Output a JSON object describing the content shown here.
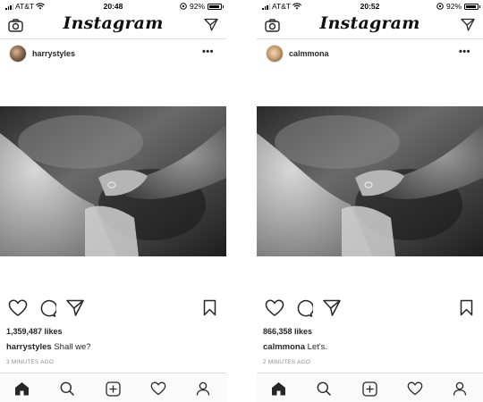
{
  "app": {
    "logo": "Instagram"
  },
  "screens": [
    {
      "status": {
        "carrier": "AT&T",
        "time": "20:48",
        "battery": "92%"
      },
      "post": {
        "username": "harrystyles",
        "likes": "1,359,487 likes",
        "caption_user": "harrystyles",
        "caption_text": " Shall we?",
        "time_ago": "3 MINUTES AGO"
      }
    },
    {
      "status": {
        "carrier": "AT&T",
        "time": "20:52",
        "battery": "92%"
      },
      "post": {
        "username": "calmmona",
        "likes": "866,358 likes",
        "caption_user": "calmmona",
        "caption_text": " Let's.",
        "time_ago": "2 MINUTES AGO"
      }
    }
  ],
  "icons": {
    "top_left": "camera-icon",
    "top_right": "direct-send-icon",
    "post_menu": "more-options-icon",
    "actions": [
      "heart-icon",
      "comment-icon",
      "share-icon",
      "bookmark-icon"
    ],
    "tabbar": [
      "home-icon",
      "search-icon",
      "add-post-icon",
      "activity-heart-icon",
      "profile-icon"
    ]
  },
  "colors": {
    "text": "#262626",
    "muted": "#8e8e8e",
    "divider": "#dbdbdb",
    "tabbar_bg": "#fafafa"
  }
}
